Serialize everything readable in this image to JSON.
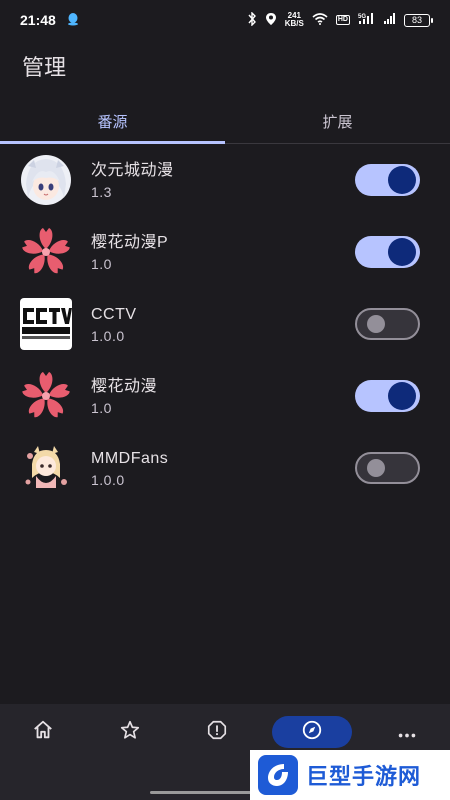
{
  "status_bar": {
    "time": "21:48",
    "net_speed_value": "241",
    "net_speed_unit": "KB/S",
    "hd_label": "HD",
    "signal_label": "5G",
    "battery_level": "83"
  },
  "header": {
    "title": "管理"
  },
  "tabs": [
    {
      "label": "番源",
      "active": true
    },
    {
      "label": "扩展",
      "active": false
    }
  ],
  "sources": [
    {
      "name": "次元城动漫",
      "version": "1.3",
      "enabled": true,
      "icon": "anime-girl-avatar-icon"
    },
    {
      "name": "樱花动漫P",
      "version": "1.0",
      "enabled": true,
      "icon": "sakura-flower-icon"
    },
    {
      "name": "CCTV",
      "version": "1.0.0",
      "enabled": false,
      "icon": "cctv-logo-icon"
    },
    {
      "name": "樱花动漫",
      "version": "1.0",
      "enabled": true,
      "icon": "sakura-flower-icon"
    },
    {
      "name": "MMDFans",
      "version": "1.0.0",
      "enabled": false,
      "icon": "mmdfans-character-icon"
    }
  ],
  "bottom_nav": [
    {
      "icon": "home-icon",
      "active": false
    },
    {
      "icon": "star-icon",
      "active": false
    },
    {
      "icon": "alert-icon",
      "active": false
    },
    {
      "icon": "compass-icon",
      "active": true
    },
    {
      "icon": "more-icon",
      "active": false
    }
  ],
  "watermark": {
    "text": "巨型手游网"
  },
  "colors": {
    "background": "#1c1b1f",
    "accent": "#b7c4ff",
    "switch_on_knob": "#0e2a7a",
    "switch_off_track": "#36343b",
    "sakura": "#e85d6f"
  }
}
